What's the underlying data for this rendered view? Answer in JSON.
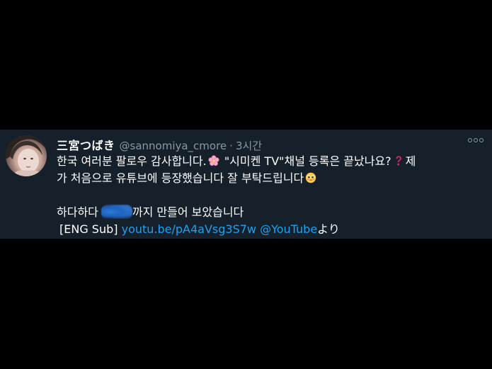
{
  "tweet": {
    "display_name": "三宮つばき",
    "handle": "@sannomiya_cmore",
    "separator": "·",
    "time": "3시간",
    "line1_a": "한국 여러분 팔로우 감사합니다.",
    "line1_b": "\"시미켄 TV\"채널 등록은 끝났나요?",
    "line1_c": "제",
    "line2_a": "가 처음으로 유튜브에 등장했습니다 잘 부탁드립니다",
    "line3_a": "하다하다",
    "line3_b": "까지 만들어 보았습니다",
    "line4_prefix": "[ENG Sub]",
    "line4_link": "youtu.be/pA4aVsg3S7w",
    "line4_mention": "@YouTube",
    "line4_suffix": "より"
  },
  "icons": {
    "avatar": "profile-photo",
    "flower": "cherry-blossom-icon",
    "question": "red-question-mark-icon",
    "face": "pleading-face-icon",
    "more": "more-options-icon"
  },
  "colors": {
    "card_bg": "#15202b",
    "page_bg": "#000000",
    "text": "#ffffff",
    "muted": "#8899a6",
    "link": "#1da1f2"
  }
}
